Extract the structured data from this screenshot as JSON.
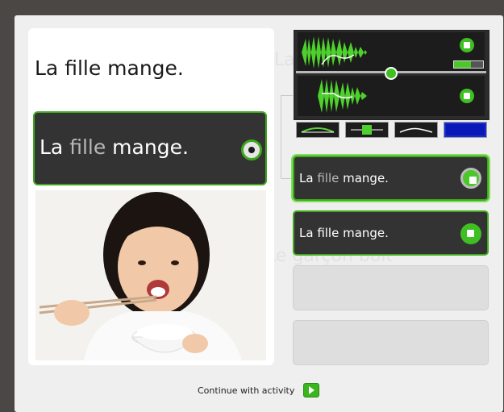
{
  "prompt": {
    "sentence": "La fille mange."
  },
  "speak_card": {
    "before": "La ",
    "highlight": "fille",
    "after": " mange."
  },
  "photo": {
    "description_icon": "photo-girl-eating-rice-icon"
  },
  "waveform_panel": {
    "top_play_icon": "speaker-icon",
    "bottom_play_icon": "speaker-icon",
    "volume_level": 0.58,
    "controls": [
      "pitch-curve-icon",
      "waveform-icon",
      "intonation-icon",
      "spectrogram-icon"
    ]
  },
  "answers": [
    {
      "before": "La ",
      "highlight": "fille",
      "after": " mange.",
      "state": "selected"
    },
    {
      "before": "",
      "highlight": "",
      "after": "La fille mange.",
      "state": "normal"
    },
    {
      "state": "empty"
    },
    {
      "state": "empty"
    }
  ],
  "background_ghost": {
    "text_1": "La",
    "text_2": "Le garçon boit"
  },
  "footer": {
    "continue_label": "Continue with activity"
  },
  "colors": {
    "accent": "#3fa81e",
    "dark_card": "#333333",
    "background": "#efefef"
  }
}
